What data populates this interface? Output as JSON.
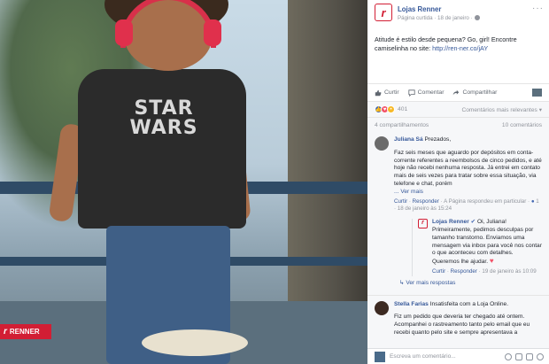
{
  "photo": {
    "shirt_text_line1": "STAR",
    "shirt_text_line2": "WARS",
    "brand_badge": "RENNER"
  },
  "post": {
    "page_name": "Lojas Renner",
    "meta": "Página curtida · 18 de janeiro ·",
    "more_icon": "more-dots-icon",
    "caption_text": "Atitude é estilo desde pequena? Go, girl! Encontre camiselinha no site: ",
    "caption_link": "http://ren-ner.co/jAY"
  },
  "actions": {
    "like": "Curtir",
    "comment": "Comentar",
    "share": "Compartilhar"
  },
  "reactions": {
    "count": "401",
    "relevance": "Comentários mais relevantes ▾"
  },
  "counts": {
    "shares": "4 compartilhamentos",
    "comments": "10 comentários"
  },
  "comments": [
    {
      "name": "Juliana Sá",
      "text_first": "Prezados,",
      "text": "Faz seis meses que aguardo por depósitos em conta-corrente referentes a reembolsos de cinco pedidos, e até hoje não recebi nenhuma resposta. Já entrei em contato mais de seis vezes para tratar sobre essa situação, via telefone e chat, porém",
      "see_more": "... Ver mais",
      "foot_like": "Curtir",
      "foot_reply": "Responder",
      "foot_note": "· A Página respondeu em particular ·",
      "foot_count": "1",
      "foot_time": "· 18 de janeiro às 15:24"
    },
    {
      "name": "Stella Farias",
      "text_first": "Insatisfeita com a Loja Online.",
      "text": "Fiz um pedido que deveria ter chegado até ontem. Acompanhei o rastreamento tanto pelo email que eu recebi quanto pelo site e sempre apresentava a"
    }
  ],
  "reply": {
    "name": "Lojas Renner",
    "text": "Oi, Juliana! Primeiramente, pedimos desculpas por tamanho transtorno. Enviamos uma mensagem via inbox para você nos contar o que aconteceu com detalhes. Queremos lhe ajudar.",
    "foot_like": "Curtir",
    "foot_reply": "Responder",
    "foot_time": "· 19 de janeiro às 10:09"
  },
  "more_replies": "Ver mais respostas",
  "writer": {
    "placeholder": "Escreva um comentário..."
  }
}
